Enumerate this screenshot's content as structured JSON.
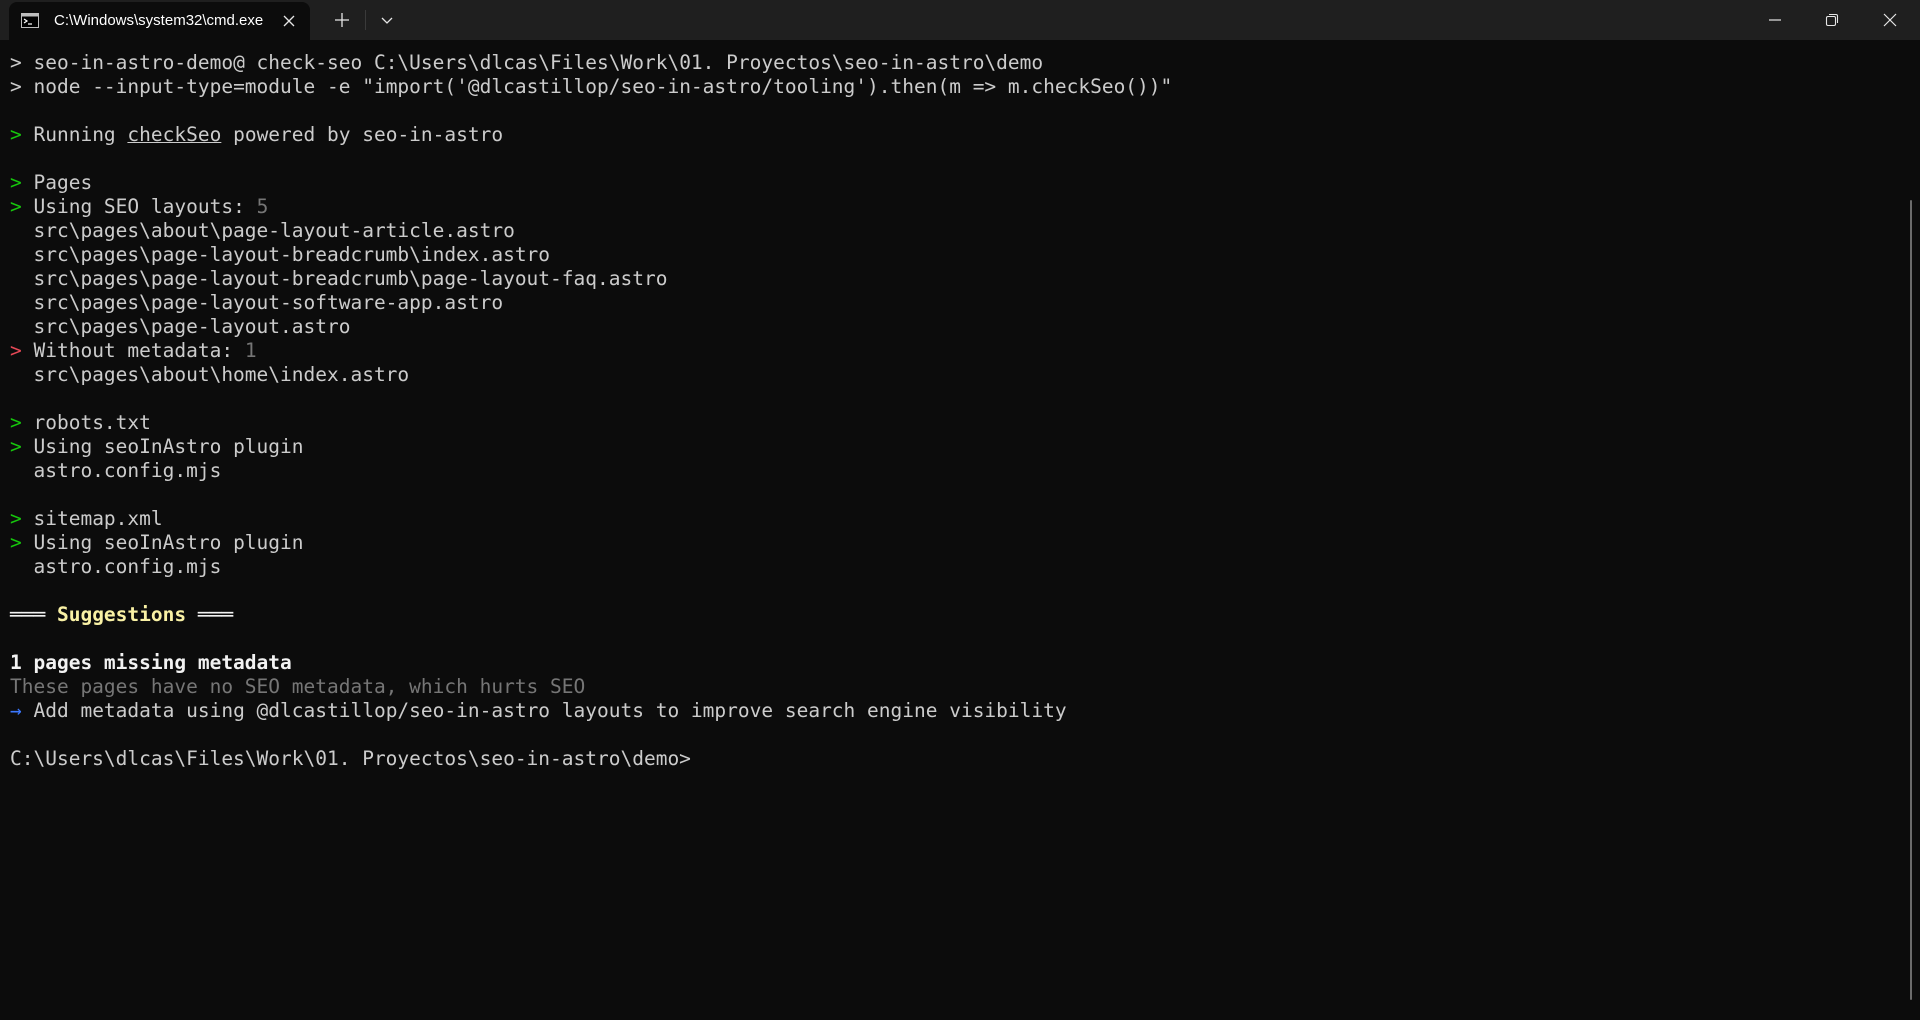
{
  "window": {
    "tab_title": "C:\\Windows\\system32\\cmd.exe",
    "new_tab_symbol": "+",
    "icons": {
      "tab_icon": "cmd-icon",
      "tab_close": "close-icon",
      "new_tab": "plus-icon",
      "dropdown": "chevron-down-icon",
      "minimize": "minimize-icon",
      "maximize": "maximize-icon",
      "close": "close-icon"
    }
  },
  "colors": {
    "background": "#0c0c0c",
    "titlebar": "#1f1f1f",
    "text": "#cccccc",
    "green": "#16c60c",
    "red": "#e74856",
    "dim": "#767676",
    "yellow": "#f9f1a5",
    "blue": "#3b78ff"
  },
  "terminal": {
    "cmd1": {
      "marker": ">",
      "text": " seo-in-astro-demo@ check-seo C:\\Users\\dlcas\\Files\\Work\\01. Proyectos\\seo-in-astro\\demo"
    },
    "cmd2": {
      "marker": ">",
      "text": " node --input-type=module -e \"import('@dlcastillop/seo-in-astro/tooling').then(m => m.checkSeo())\""
    },
    "running": {
      "marker": ">",
      "prefix": " Running ",
      "link": "checkSeo",
      "suffix": " powered by seo-in-astro"
    },
    "pages": {
      "marker": ">",
      "label": " Pages"
    },
    "seo_layouts": {
      "marker": ">",
      "label": " Using SEO layouts: ",
      "count": "5",
      "files": [
        "  src\\pages\\about\\page-layout-article.astro",
        "  src\\pages\\page-layout-breadcrumb\\index.astro",
        "  src\\pages\\page-layout-breadcrumb\\page-layout-faq.astro",
        "  src\\pages\\page-layout-software-app.astro",
        "  src\\pages\\page-layout.astro"
      ]
    },
    "without_metadata": {
      "marker": ">",
      "label": " Without metadata: ",
      "count": "1",
      "files": [
        "  src\\pages\\about\\home\\index.astro"
      ]
    },
    "robots": {
      "marker": ">",
      "label": " robots.txt",
      "plugin_marker": ">",
      "plugin": " Using seoInAstro plugin",
      "config": "  astro.config.mjs"
    },
    "sitemap": {
      "marker": ">",
      "label": " sitemap.xml",
      "plugin_marker": ">",
      "plugin": " Using seoInAstro plugin",
      "config": "  astro.config.mjs"
    },
    "suggestions": {
      "rule_left": "═══",
      "title": " Suggestions ",
      "rule_right": "═══",
      "heading": "1 pages missing metadata",
      "description": "These pages have no SEO metadata, which hurts SEO",
      "arrow": "→",
      "action": " Add metadata using @dlcastillop/seo-in-astro layouts to improve search engine visibility"
    },
    "prompt": "C:\\Users\\dlcas\\Files\\Work\\01. Proyectos\\seo-in-astro\\demo>"
  }
}
